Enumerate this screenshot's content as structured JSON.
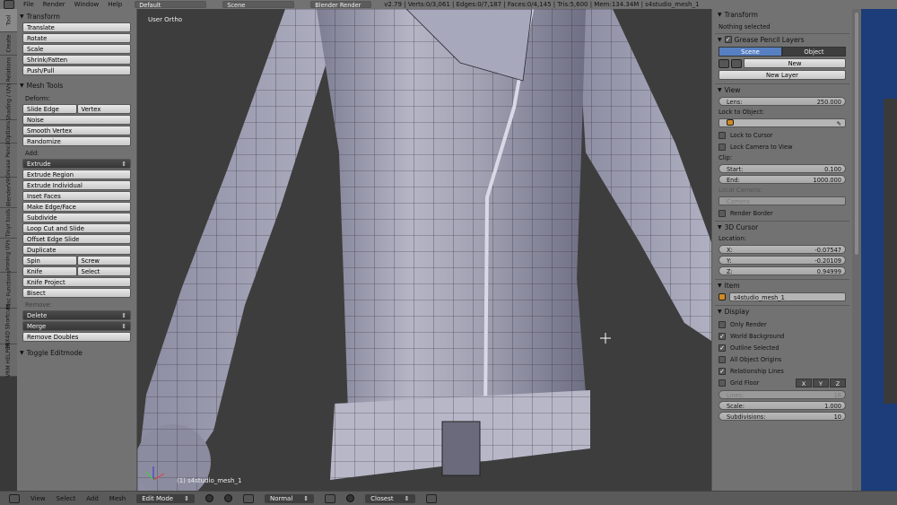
{
  "topbar": {
    "menus": [
      "File",
      "Render",
      "Window",
      "Help"
    ],
    "layout": "Default",
    "scene": "Scene",
    "engine": "Blender Render",
    "stats": "v2.79 | Verts:0/3,061 | Edges:0/7,187 | Faces:0/4,145 | Tris:5,600 | Mem:134.34M | s4studio_mesh_1"
  },
  "tabs": [
    "Tool",
    "Create",
    "Relations",
    "Shading / UVs",
    "Options",
    "Grease Pencil",
    "BlenderVR",
    "Tinyr tools",
    "Ironing UVs",
    "Misc Functions",
    "MIX4D Shortcuts",
    "VRM HELPER"
  ],
  "tools": {
    "transform_header": "Transform",
    "transform": [
      "Translate",
      "Rotate",
      "Scale",
      "Shrink/Fatten",
      "Push/Pull"
    ],
    "meshtools_header": "Mesh Tools",
    "deform_label": "Deform:",
    "slide_edge": "Slide Edge",
    "vertex": "Vertex",
    "noise": "Noise",
    "smooth_vertex": "Smooth Vertex",
    "randomize": "Randomize",
    "add_label": "Add:",
    "extrude": "Extrude",
    "extrude_region": "Extrude Region",
    "extrude_individual": "Extrude Individual",
    "inset_faces": "Inset Faces",
    "make_edge_face": "Make Edge/Face",
    "subdivide": "Subdivide",
    "loop_cut": "Loop Cut and Slide",
    "offset_edge": "Offset Edge Slide",
    "duplicate": "Duplicate",
    "spin": "Spin",
    "screw": "Screw",
    "knife": "Knife",
    "select": "Select",
    "knife_project": "Knife Project",
    "bisect": "Bisect",
    "remove_label": "Remove:",
    "delete": "Delete",
    "merge": "Merge",
    "remove_doubles": "Remove Doubles",
    "toggle_editmode": "Toggle Editmode"
  },
  "viewport": {
    "title": "User Ortho",
    "object": "(1) s4studio_mesh_1"
  },
  "props": {
    "transform_header": "Transform",
    "nothing_selected": "Nothing selected",
    "grease_header": "Grease Pencil Layers",
    "scene_tab": "Scene",
    "object_tab": "Object",
    "new": "New",
    "new_layer": "New Layer",
    "view_header": "View",
    "lens_label": "Lens:",
    "lens_value": "250.000",
    "lock_to_object": "Lock to Object:",
    "lock_to_cursor": "Lock to Cursor",
    "lock_camera": "Lock Camera to View",
    "clip_label": "Clip:",
    "start_label": "Start:",
    "start_value": "0.100",
    "end_label": "End:",
    "end_value": "1000.000",
    "local_camera": "Local Camera:",
    "camera": "Camera",
    "render_border": "Render Border",
    "cursor_header": "3D Cursor",
    "location_label": "Location:",
    "x_label": "X:",
    "x_value": "-0.07547",
    "y_label": "Y:",
    "y_value": "-0.20109",
    "z_label": "Z:",
    "z_value": "0.94999",
    "item_header": "Item",
    "item_name": "s4studio_mesh_1",
    "display_header": "Display",
    "only_render": "Only Render",
    "world_background": "World Background",
    "outline_selected": "Outline Selected",
    "all_object_origins": "All Object Origins",
    "relationship_lines": "Relationship Lines",
    "grid_floor": "Grid Floor",
    "axis_x": "X",
    "axis_y": "Y",
    "axis_z": "Z",
    "lines_label": "Lines:",
    "lines_value": "16",
    "scale_label": "Scale:",
    "scale_value": "1.000",
    "subdivisions_label": "Subdivisions:",
    "subdivisions_value": "10"
  },
  "bottom": {
    "menus": [
      "View",
      "Select",
      "Add",
      "Mesh"
    ],
    "mode": "Edit Mode",
    "pivot": "Normal",
    "snap": "Closest"
  }
}
